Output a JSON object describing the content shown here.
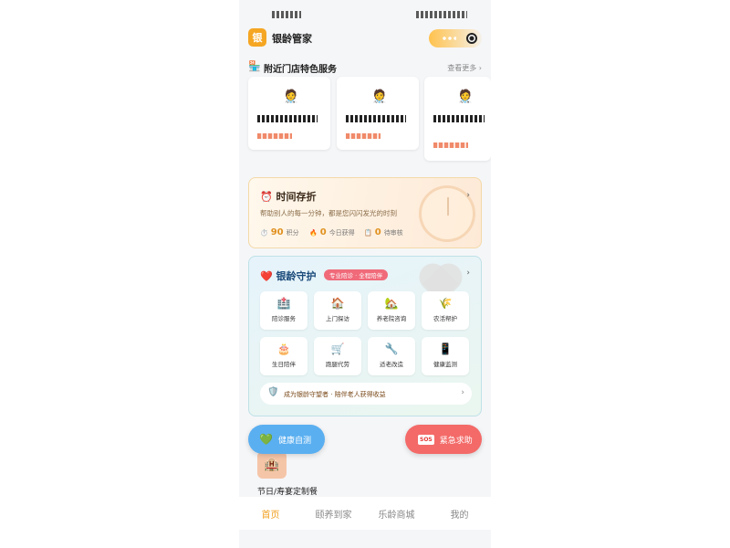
{
  "header": {
    "logo_text": "银",
    "title": "银龄管家"
  },
  "nearby": {
    "icon": "🏪",
    "title": "附近门店特色服务",
    "more_label": "查看更多 ›",
    "cards": [
      {
        "icon": "🧑‍⚕️"
      },
      {
        "icon": "🧑‍⚕️"
      },
      {
        "icon": "🧑‍⚕️"
      }
    ]
  },
  "time_bank": {
    "icon": "⏰",
    "title": "时间存折",
    "subtitle": "帮助别人的每一分钟，都是您闪闪发光的时刻",
    "arrow": "›",
    "stats": [
      {
        "icon": "⏱️",
        "value": "90",
        "label": "积分"
      },
      {
        "icon": "🔥",
        "value": "0",
        "label": "今日获得"
      },
      {
        "icon": "📋",
        "value": "0",
        "label": "待审核"
      }
    ]
  },
  "guard": {
    "icon": "❤️",
    "title": "银龄守护",
    "badge": "专业陪诊 · 全程陪伴",
    "arrow": "›",
    "services": [
      {
        "icon": "🏥",
        "label": "陪诊服务"
      },
      {
        "icon": "🏠",
        "label": "上门探访"
      },
      {
        "icon": "🏡",
        "label": "养老院咨询"
      },
      {
        "icon": "🌾",
        "label": "农活帮护"
      },
      {
        "icon": "🎂",
        "label": "生日陪伴"
      },
      {
        "icon": "🛒",
        "label": "跑腿代劳"
      },
      {
        "icon": "🔧",
        "label": "适老改造"
      },
      {
        "icon": "📱",
        "label": "健康监测"
      }
    ],
    "recruit": {
      "icon": "🛡️",
      "text": "成为银龄守望者 · 陪伴老人获得收益",
      "arrow": "›"
    }
  },
  "floating": {
    "health": {
      "icon": "💚",
      "label": "健康自测"
    },
    "sos": {
      "badge": "SOS",
      "label": "紧急求助"
    }
  },
  "banquet": {
    "icon": "🏨",
    "label": "节日/寿宴定制餐"
  },
  "tabs": [
    {
      "label": "首页",
      "active": true
    },
    {
      "label": "颐养到家",
      "active": false
    },
    {
      "label": "乐龄商城",
      "active": false
    },
    {
      "label": "我的",
      "active": false
    }
  ],
  "colors": {
    "accent": "#f0a020",
    "sos": "#f36a68",
    "health": "#5aaff0"
  }
}
